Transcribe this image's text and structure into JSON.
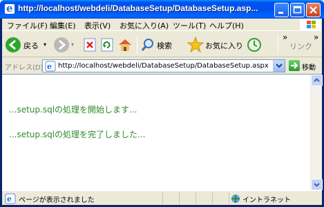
{
  "window": {
    "title": "http://localhost/webdeli/DatabaseSetup/DatabaseSetup.asp..."
  },
  "menu": {
    "items": [
      "ファイル(F)",
      "編集(E)",
      "表示(V)",
      "お気に入り(A)",
      "ツール(T)",
      "ヘルプ(H)"
    ]
  },
  "toolbar": {
    "back_label": "戻る",
    "search_label": "検索",
    "favorites_label": "お気に入り",
    "links_label": "リンク",
    "overflow": "»"
  },
  "address": {
    "label": "アドレス(D)",
    "url": "http://localhost/webdeli/DatabaseSetup/DatabaseSetup.aspx",
    "go_label": "移動"
  },
  "content": {
    "messages": [
      "...setup.sqlの処理を開始します...",
      "...setup.sqlの処理を完了しました..."
    ]
  },
  "status": {
    "text": "ページが表示されました",
    "zone": "イントラネット"
  },
  "colors": {
    "titlebar": "#0053ee",
    "message": "#2e8b2e"
  },
  "icons": [
    "ie-icon",
    "minimize-icon",
    "maximize-icon",
    "close-icon",
    "windows-logo-icon",
    "back-arrow-icon",
    "forward-arrow-icon",
    "stop-icon",
    "refresh-icon",
    "home-icon",
    "search-icon",
    "favorites-star-icon",
    "history-icon",
    "go-arrow-icon",
    "page-icon",
    "intranet-icon"
  ]
}
